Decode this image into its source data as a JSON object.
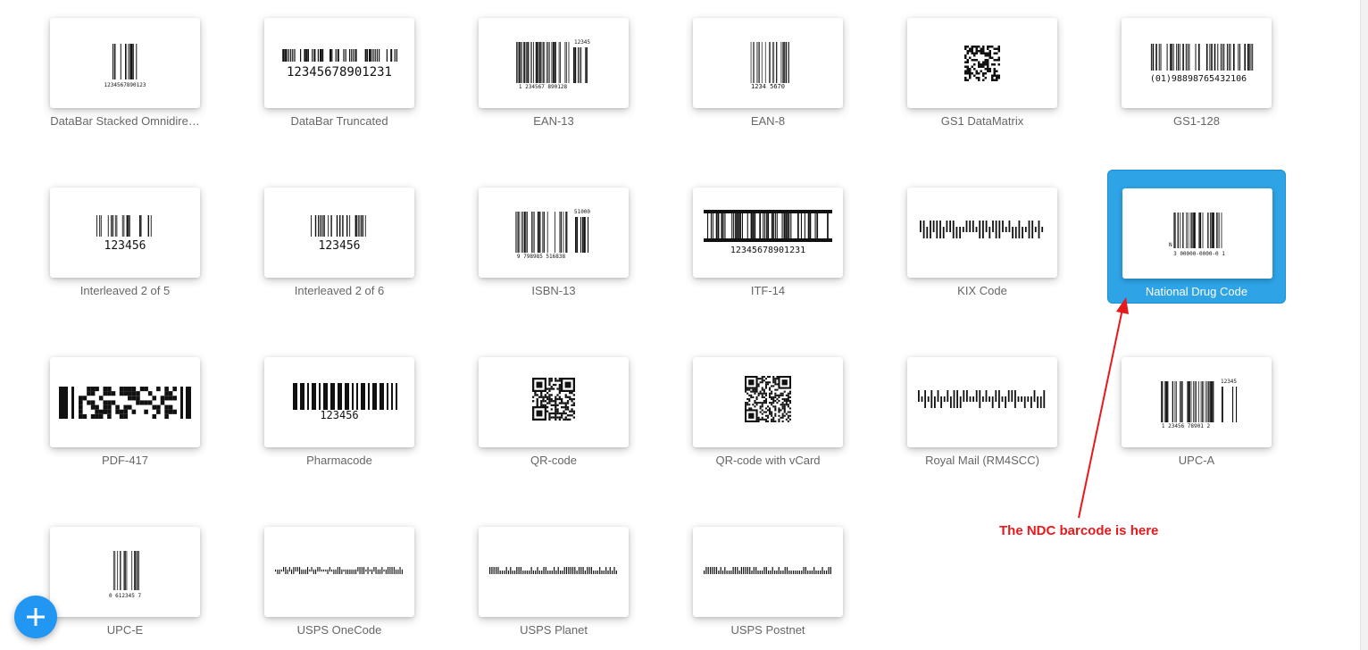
{
  "tiles": [
    {
      "label": "DataBar Stacked Omnidire…",
      "icon": "databar-stacked-barcode-icon",
      "digits": "1234567890123"
    },
    {
      "label": "DataBar Truncated",
      "icon": "databar-truncated-barcode-icon",
      "digits": "12345678901231"
    },
    {
      "label": "EAN-13",
      "icon": "ean13-barcode-icon",
      "digits": "1 234567 890128",
      "addon": "12345"
    },
    {
      "label": "EAN-8",
      "icon": "ean8-barcode-icon",
      "digits": "1234 5670"
    },
    {
      "label": "GS1 DataMatrix",
      "icon": "datamatrix-icon",
      "digits": ""
    },
    {
      "label": "GS1-128",
      "icon": "gs1-128-barcode-icon",
      "digits": "(01)98898765432106"
    },
    {
      "label": "Interleaved 2 of 5",
      "icon": "interleaved-2of5-barcode-icon",
      "digits": "123456"
    },
    {
      "label": "Interleaved 2 of 6",
      "icon": "interleaved-2of6-barcode-icon",
      "digits": "123456"
    },
    {
      "label": "ISBN-13",
      "icon": "isbn13-barcode-icon",
      "digits": "9 798985 516838",
      "addon": "51000"
    },
    {
      "label": "ITF-14",
      "icon": "itf14-barcode-icon",
      "digits": "12345678901231"
    },
    {
      "label": "KIX Code",
      "icon": "kix-postal-barcode-icon",
      "digits": ""
    },
    {
      "label": "National Drug Code",
      "icon": "ndc-barcode-icon",
      "digits": "3 00000-0000-0 1",
      "prefix": "N"
    },
    {
      "label": "PDF-417",
      "icon": "pdf417-barcode-icon",
      "digits": ""
    },
    {
      "label": "Pharmacode",
      "icon": "pharmacode-barcode-icon",
      "digits": "123456"
    },
    {
      "label": "QR-code",
      "icon": "qr-code-icon",
      "digits": ""
    },
    {
      "label": "QR-code with vCard",
      "icon": "qr-vcard-icon",
      "digits": ""
    },
    {
      "label": "Royal Mail (RM4SCC)",
      "icon": "royal-mail-barcode-icon",
      "digits": ""
    },
    {
      "label": "UPC-A",
      "icon": "upca-barcode-icon",
      "digits": "1 23456 78901 2",
      "addon": "12345"
    },
    {
      "label": "UPC-E",
      "icon": "upce-barcode-icon",
      "digits": "0 612345 7"
    },
    {
      "label": "USPS OneCode",
      "icon": "usps-onecode-barcode-icon",
      "digits": ""
    },
    {
      "label": "USPS Planet",
      "icon": "usps-planet-barcode-icon",
      "digits": ""
    },
    {
      "label": "USPS Postnet",
      "icon": "usps-postnet-barcode-icon",
      "digits": ""
    }
  ],
  "selected_tile": "National Drug Code",
  "annotation": {
    "text": "The NDC barcode is here",
    "color": "#e8191c"
  },
  "fab": {
    "icon": "plus-icon",
    "color": "#2196f3"
  },
  "colors": {
    "selected": "#2ea3e6",
    "label": "#666666"
  }
}
